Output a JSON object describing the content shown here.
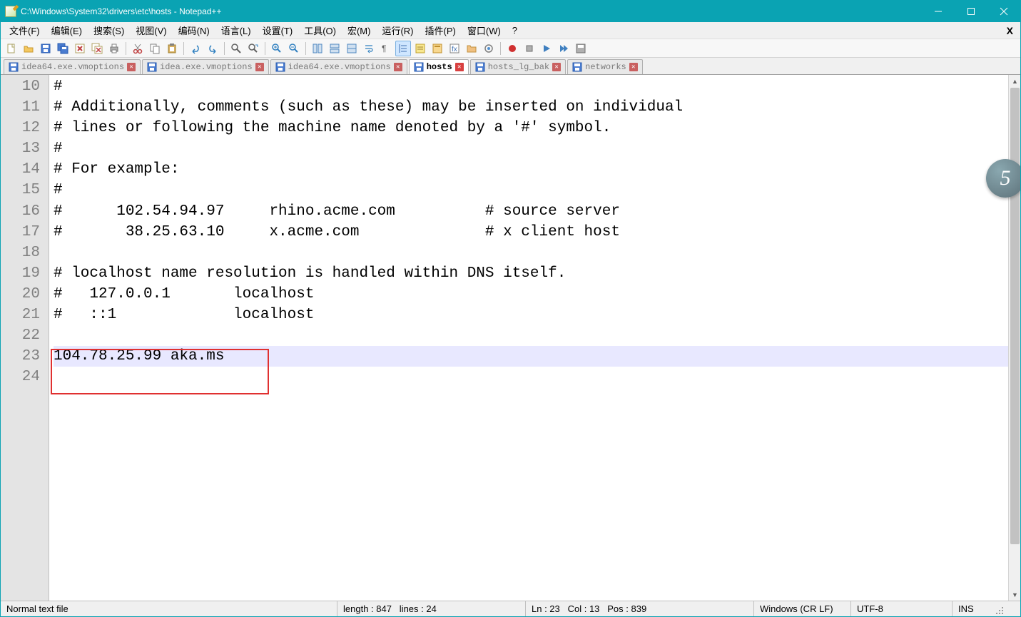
{
  "title": "C:\\Windows\\System32\\drivers\\etc\\hosts - Notepad++",
  "menus": {
    "file": "文件(F)",
    "edit": "编辑(E)",
    "search": "搜索(S)",
    "view": "视图(V)",
    "encoding": "编码(N)",
    "language": "语言(L)",
    "settings": "设置(T)",
    "tools": "工具(O)",
    "macro": "宏(M)",
    "run": "运行(R)",
    "plugins": "插件(P)",
    "window": "窗口(W)",
    "help": "?"
  },
  "tabs": [
    {
      "label": "idea64.exe.vmoptions",
      "active": false
    },
    {
      "label": "idea.exe.vmoptions",
      "active": false
    },
    {
      "label": "idea64.exe.vmoptions",
      "active": false
    },
    {
      "label": "hosts",
      "active": true
    },
    {
      "label": "hosts_lg_bak",
      "active": false
    },
    {
      "label": "networks",
      "active": false
    }
  ],
  "gutter_start": 10,
  "lines": [
    "#",
    "# Additionally, comments (such as these) may be inserted on individual",
    "# lines or following the machine name denoted by a '#' symbol.",
    "#",
    "# For example:",
    "#",
    "#      102.54.94.97     rhino.acme.com          # source server",
    "#       38.25.63.10     x.acme.com              # x client host",
    "",
    "# localhost name resolution is handled within DNS itself.",
    "#   127.0.0.1       localhost",
    "#   ::1             localhost",
    "",
    "104.78.25.99 aka.ms",
    ""
  ],
  "current_line_index": 13,
  "status": {
    "filetype": "Normal text file",
    "length_label": "length : 847",
    "lines_label": "lines : 24",
    "ln_label": "Ln : 23",
    "col_label": "Col : 13",
    "pos_label": "Pos : 839",
    "eol": "Windows (CR LF)",
    "encoding": "UTF-8",
    "ins": "INS"
  },
  "badge": "5"
}
